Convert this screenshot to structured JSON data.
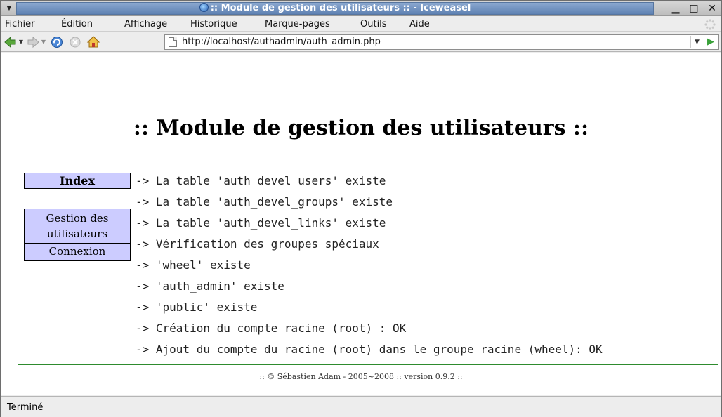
{
  "window": {
    "title": ":: Module de gestion des utilisateurs :: - Iceweasel",
    "controls": {
      "minimize": "▁",
      "maximize": "□",
      "close": "✕"
    }
  },
  "menubar": {
    "items": [
      {
        "label": "Fichier"
      },
      {
        "label": "Édition"
      },
      {
        "label": "Affichage"
      },
      {
        "label": "Historique"
      },
      {
        "label": "Marque-pages"
      },
      {
        "label": "Outils"
      },
      {
        "label": "Aide"
      }
    ]
  },
  "navbar": {
    "url": "http://localhost/authadmin/auth_admin.php",
    "icons": [
      "back-icon",
      "forward-icon",
      "reload-icon",
      "stop-icon",
      "home-icon"
    ]
  },
  "page": {
    "title": ":: Module de gestion des utilisateurs ::",
    "nav": {
      "index": "Index",
      "users_line1": "Gestion des",
      "users_line2": "utilisateurs",
      "connexion": "Connexion"
    },
    "log": [
      "-> La table 'auth_devel_users' existe",
      "-> La table 'auth_devel_groups' existe",
      "-> La table 'auth_devel_links' existe",
      "-> Vérification des groupes spéciaux",
      "-> 'wheel' existe",
      "-> 'auth_admin' existe",
      "-> 'public' existe",
      "-> Création du compte racine (root) : OK",
      "-> Ajout du compte du racine (root) dans le groupe racine (wheel): OK"
    ],
    "footer": ":: © Sébastien Adam - 2005~2008 :: version 0.9.2 ::"
  },
  "status": {
    "text": "Terminé"
  }
}
